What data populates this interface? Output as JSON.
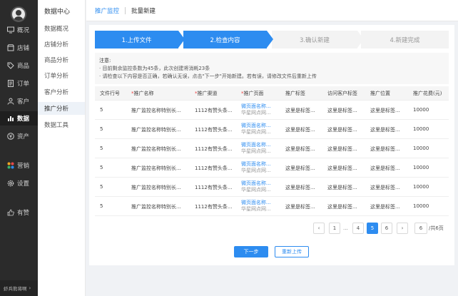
{
  "nav": {
    "items": [
      {
        "label": "概况",
        "icon": "monitor-icon"
      },
      {
        "label": "店铺",
        "icon": "store-icon"
      },
      {
        "label": "商品",
        "icon": "tag-icon"
      },
      {
        "label": "订单",
        "icon": "order-icon"
      },
      {
        "label": "客户",
        "icon": "customer-icon"
      },
      {
        "label": "数据",
        "icon": "bar-chart-icon"
      },
      {
        "label": "资产",
        "icon": "yen-icon"
      },
      {
        "label": "营销",
        "icon": "grid-icon"
      },
      {
        "label": "设置",
        "icon": "gear-icon"
      },
      {
        "label": "有赞",
        "icon": "thumb-up-icon"
      }
    ],
    "footer": "虾兵熊将啊"
  },
  "subnav": {
    "title": "数据中心",
    "items": [
      "数据概况",
      "店铺分析",
      "商品分析",
      "订单分析",
      "客户分析",
      "推广分析",
      "数据工具"
    ]
  },
  "breadcrumb": {
    "parent": "推广监控",
    "current": "批量新建"
  },
  "steps": [
    "1.上传文件",
    "2.检查内容",
    "3.确认新建",
    "4.新建完成"
  ],
  "notice": {
    "title": "注意:",
    "line1": "· 目前剩余监控条数为45条，此次创建将消耗23条",
    "line2": "· 请检查以下内容是否正确，若确认无误，点击\"下一步\"开始新建。若有误，请修改文件后重新上传"
  },
  "table": {
    "headers": [
      "文件行号",
      "推广名称",
      "推广渠道",
      "推广页面",
      "推广标签",
      "访问客户标签",
      "推广位置",
      "推广花费(元)"
    ],
    "rows": [
      {
        "line": "5",
        "name": "推广监控名称特别长...",
        "channel": "1112有赞头条...",
        "page_title": "微页面名称...",
        "page_sub": "华星网点网...",
        "tag": "这里是标签...",
        "visitor_tag": "这里是标签...",
        "position": "这里是标签...",
        "cost": "10000"
      },
      {
        "line": "5",
        "name": "推广监控名称特别长...",
        "channel": "1112有赞头条...",
        "page_title": "微页面名称...",
        "page_sub": "华星网点网...",
        "tag": "这里是标签...",
        "visitor_tag": "这里是标签...",
        "position": "这里是标签...",
        "cost": "10000"
      },
      {
        "line": "5",
        "name": "推广监控名称特别长...",
        "channel": "1112有赞头条...",
        "page_title": "微页面名称...",
        "page_sub": "华星网点网...",
        "tag": "这里是标签...",
        "visitor_tag": "这里是标签...",
        "position": "这里是标签...",
        "cost": "10000"
      },
      {
        "line": "5",
        "name": "推广监控名称特别长...",
        "channel": "1112有赞头条...",
        "page_title": "微页面名称...",
        "page_sub": "华星网点网...",
        "tag": "这里是标签...",
        "visitor_tag": "这里是标签...",
        "position": "这里是标签...",
        "cost": "10000"
      },
      {
        "line": "5",
        "name": "推广监控名称特别长...",
        "channel": "1112有赞头条...",
        "page_title": "微页面名称...",
        "page_sub": "华星网点网...",
        "tag": "这里是标签...",
        "visitor_tag": "这里是标签...",
        "position": "这里是标签...",
        "cost": "10000"
      },
      {
        "line": "5",
        "name": "推广监控名称特别长...",
        "channel": "1112有赞头条...",
        "page_title": "微页面名称...",
        "page_sub": "华星网点网...",
        "tag": "这里是标签...",
        "visitor_tag": "这里是标签...",
        "position": "这里是标签...",
        "cost": "10000"
      }
    ]
  },
  "pagination": {
    "prev": "‹",
    "pages": [
      "1",
      "...",
      "4",
      "5",
      "6"
    ],
    "current": "5",
    "next": "›",
    "jump_value": "6",
    "total": "/共6页"
  },
  "actions": {
    "next": "下一步",
    "reupload": "重新上传"
  },
  "colors": {
    "accent": "#2d8cf0",
    "nav_bg": "#2b2b2b",
    "required": "#f04040"
  }
}
